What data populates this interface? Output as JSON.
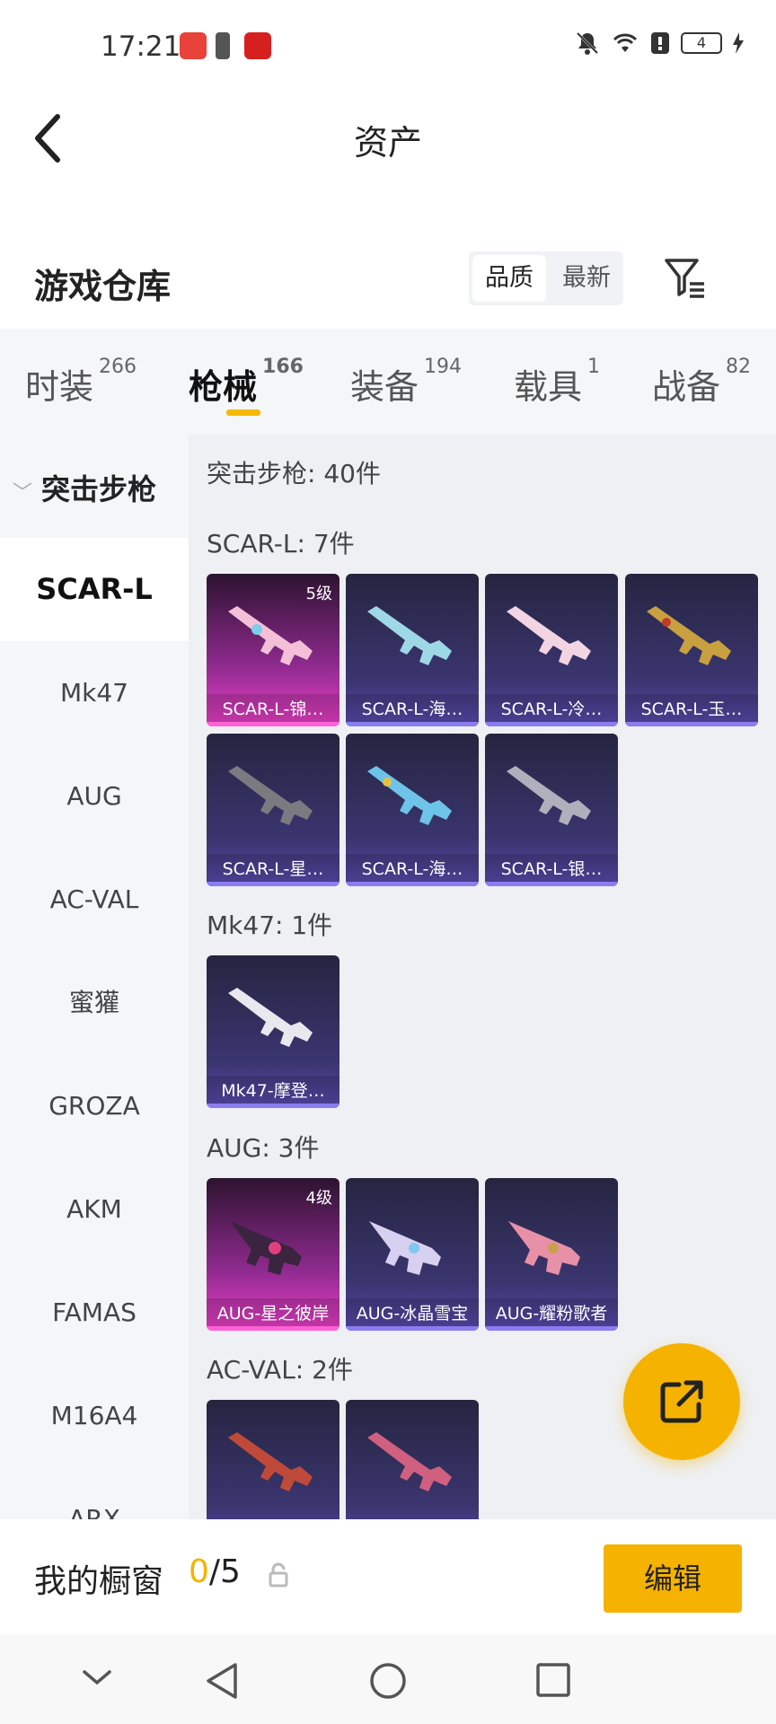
{
  "status_bar": {
    "time": "17:21",
    "battery": "4"
  },
  "header": {
    "title": "资产"
  },
  "warehouse": {
    "title": "游戏仓库",
    "sort_options": [
      "品质",
      "最新"
    ]
  },
  "tabs": [
    {
      "label": "时装",
      "count": "266"
    },
    {
      "label": "枪械",
      "count": "166"
    },
    {
      "label": "装备",
      "count": "194"
    },
    {
      "label": "载具",
      "count": "1"
    },
    {
      "label": "战备",
      "count": "82"
    }
  ],
  "sidebar": {
    "category": "突击步枪",
    "items": [
      "SCAR-L",
      "Mk47",
      "AUG",
      "AC-VAL",
      "蜜獾",
      "GROZA",
      "AKM",
      "FAMAS",
      "M16A4",
      "ARX"
    ]
  },
  "content": {
    "summary": "突击步枪: 40件",
    "sections": [
      {
        "title": "SCAR-L: 7件",
        "items": [
          {
            "label": "SCAR-L-锦…",
            "level": "5级"
          },
          {
            "label": "SCAR-L-海…"
          },
          {
            "label": "SCAR-L-冷…"
          },
          {
            "label": "SCAR-L-玉…"
          },
          {
            "label": "SCAR-L-星…"
          },
          {
            "label": "SCAR-L-海…"
          },
          {
            "label": "SCAR-L-银…"
          }
        ]
      },
      {
        "title": "Mk47: 1件",
        "items": [
          {
            "label": "Mk47-摩登…"
          }
        ]
      },
      {
        "title": "AUG: 3件",
        "items": [
          {
            "label": "AUG-星之彼岸",
            "level": "4级"
          },
          {
            "label": "AUG-冰晶雪宝"
          },
          {
            "label": "AUG-耀粉歌者"
          }
        ]
      },
      {
        "title": "AC-VAL: 2件",
        "items": [
          {
            "label": ""
          },
          {
            "label": ""
          }
        ]
      }
    ]
  },
  "showcase": {
    "label": "我的橱窗",
    "current": "0",
    "total": "/5",
    "edit_label": "编辑"
  },
  "colors": {
    "accent": "#f5b300",
    "rare_pink": "#ec40c8",
    "card_purple": "#5a4bb0"
  }
}
